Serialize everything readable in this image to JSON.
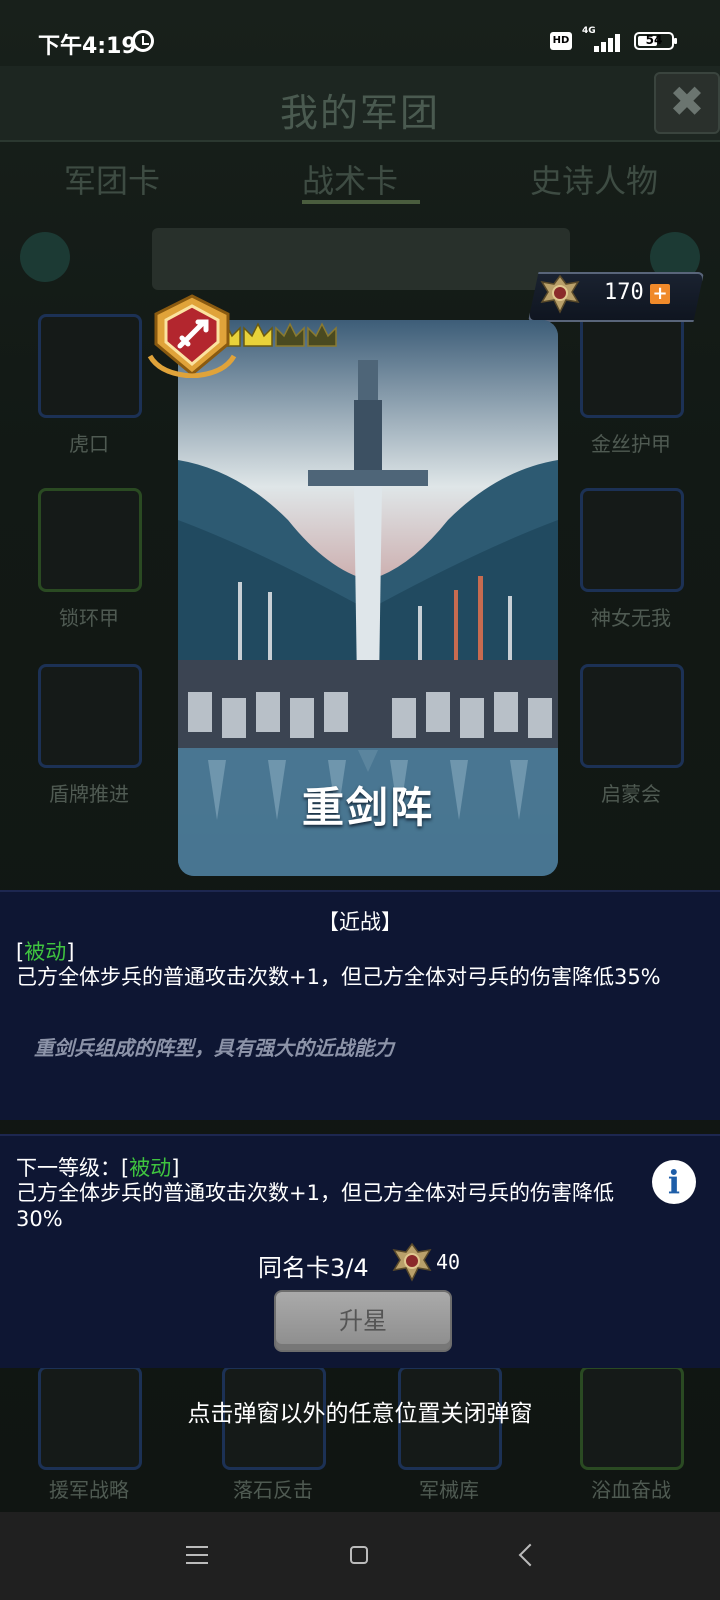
{
  "status_bar": {
    "time": "下午4:19",
    "hd": "HD",
    "network": "4G",
    "battery": "54"
  },
  "background": {
    "title": "我的军团",
    "close_symbol": "✖",
    "tabs": [
      "军团卡",
      "战术卡",
      "史诗人物"
    ],
    "active_tab": "战术卡",
    "card_labels": [
      "虎口",
      "金丝护甲",
      "锁环甲",
      "神女无我",
      "盾牌推进",
      "启蒙会",
      "援军战略",
      "落石反击",
      "军械库",
      "浴血奋战"
    ]
  },
  "currency": {
    "value": "170",
    "plus_symbol": "+"
  },
  "card": {
    "name": "重剑阵",
    "stars_filled": 3,
    "stars_total": 5
  },
  "details": {
    "tag": "【近战】",
    "passive_open": "[",
    "passive_word": "被动",
    "passive_close": "]",
    "description": "己方全体步兵的普通攻击次数+1，但己方全体对弓兵的伤害降低35%",
    "flavor": "重剑兵组成的阵型，具有强大的近战能力"
  },
  "next_level": {
    "prefix": "下一等级：[",
    "passive_word": "被动",
    "close": "]",
    "description": "己方全体步兵的普通攻击次数+1，但己方全体对弓兵的伤害降低30%",
    "info_symbol": "i"
  },
  "upgrade": {
    "duplicate_text": "同名卡3/4",
    "cost": "40",
    "button_label": "升星"
  },
  "close_hint": "点击弹窗以外的任意位置关闭弹窗",
  "colors": {
    "passive_green": "#3fc43f",
    "panel_bg": "#0e1633",
    "crown_gold": "#e8d23a",
    "badge_gold": "#e0a33a",
    "badge_red": "#b3262e"
  }
}
